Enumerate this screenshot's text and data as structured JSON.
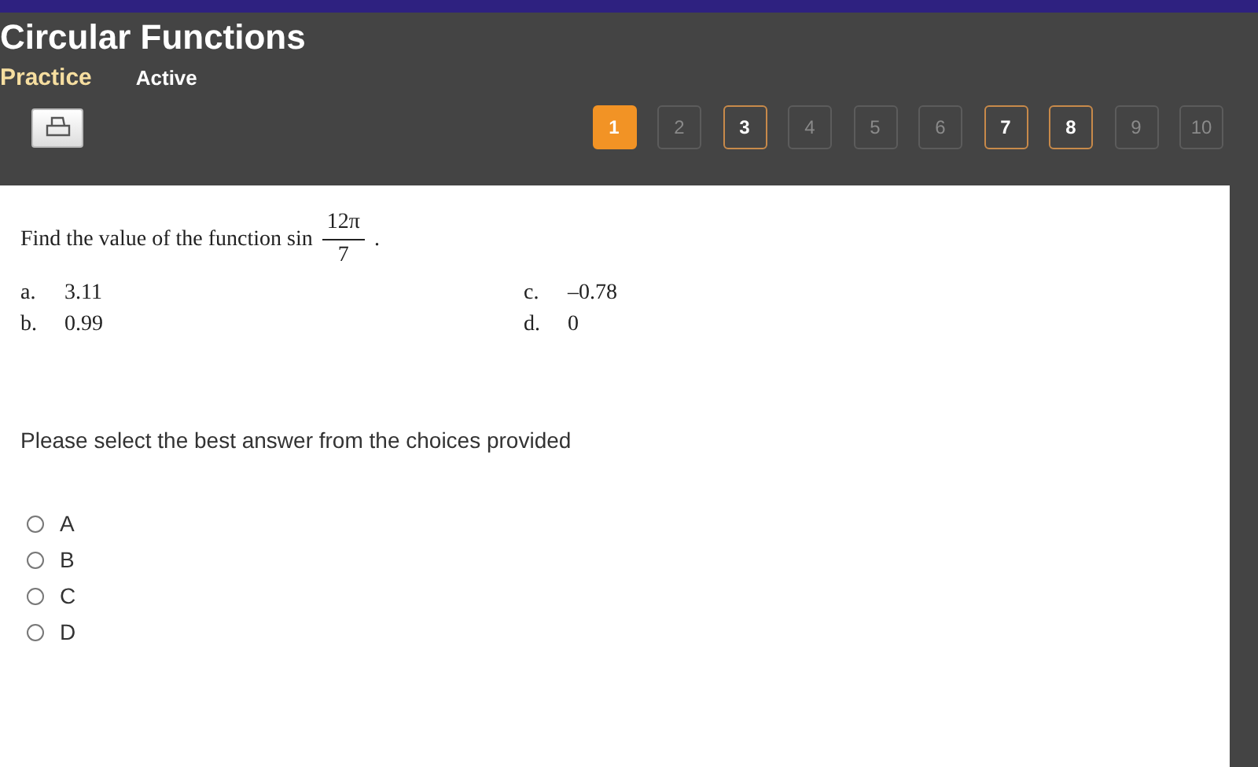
{
  "header": {
    "title": "Circular Functions",
    "mode": "Practice",
    "status": "Active"
  },
  "pages": [
    {
      "label": "1",
      "selected": true,
      "answered": false,
      "disabled": false
    },
    {
      "label": "2",
      "selected": false,
      "answered": false,
      "disabled": true
    },
    {
      "label": "3",
      "selected": false,
      "answered": true,
      "disabled": false
    },
    {
      "label": "4",
      "selected": false,
      "answered": false,
      "disabled": true
    },
    {
      "label": "5",
      "selected": false,
      "answered": false,
      "disabled": true
    },
    {
      "label": "6",
      "selected": false,
      "answered": false,
      "disabled": true
    },
    {
      "label": "7",
      "selected": false,
      "answered": true,
      "disabled": false
    },
    {
      "label": "8",
      "selected": false,
      "answered": true,
      "disabled": false
    },
    {
      "label": "9",
      "selected": false,
      "answered": false,
      "disabled": true
    },
    {
      "label": "10",
      "selected": false,
      "answered": false,
      "disabled": true
    }
  ],
  "question": {
    "prefix": "Find the value of the function sin",
    "numerator": "12π",
    "denominator": "7",
    "suffix": "."
  },
  "options": [
    {
      "letter": "a.",
      "value": "3.11"
    },
    {
      "letter": "b.",
      "value": "0.99"
    },
    {
      "letter": "c.",
      "value": "–0.78"
    },
    {
      "letter": "d.",
      "value": "0"
    }
  ],
  "prompt": "Please select the best answer from the choices provided",
  "choices": [
    {
      "label": "A",
      "selected": false
    },
    {
      "label": "B",
      "selected": false
    },
    {
      "label": "C",
      "selected": false
    },
    {
      "label": "D",
      "selected": false
    }
  ]
}
